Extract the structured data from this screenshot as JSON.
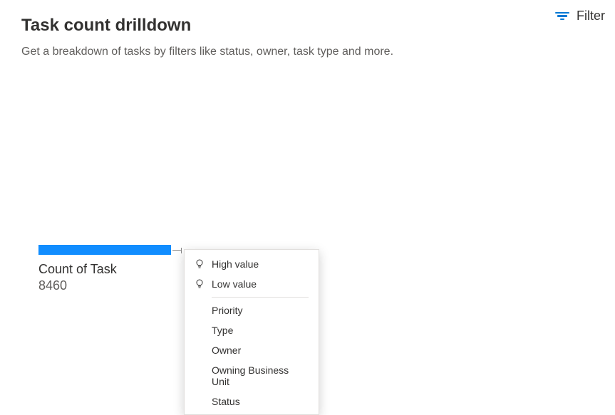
{
  "header": {
    "title": "Task count drilldown",
    "subtitle": "Get a breakdown of tasks by filters like status, owner, task type and more.",
    "filter_label": "Filter"
  },
  "chart_data": {
    "type": "bar",
    "categories": [
      "Count of Task"
    ],
    "values": [
      8460
    ],
    "title": "",
    "xlabel": "",
    "ylabel": ""
  },
  "summary": {
    "label": "Count of Task",
    "value": "8460"
  },
  "drill_menu": {
    "high": "High value",
    "low": "Low value",
    "items": [
      "Priority",
      "Type",
      "Owner",
      "Owning Business Unit",
      "Status"
    ]
  }
}
